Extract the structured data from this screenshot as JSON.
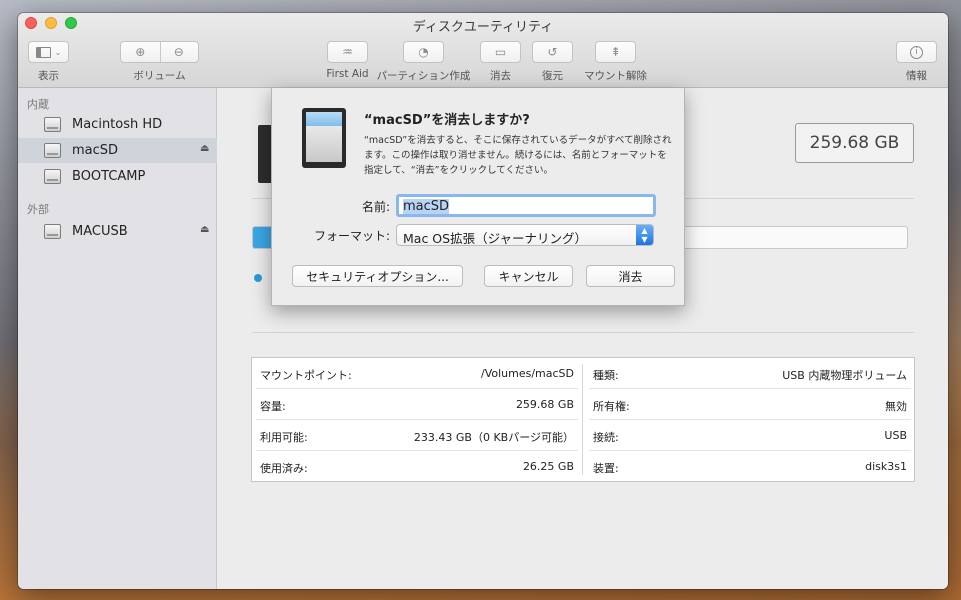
{
  "window": {
    "title": "ディスクユーティリティ"
  },
  "toolbar": {
    "view_label": "表示",
    "volume_label": "ボリューム",
    "first_aid_label": "First Aid",
    "partition_label": "パーティション作成",
    "erase_label": "消去",
    "restore_label": "復元",
    "unmount_label": "マウント解除",
    "info_label": "情報"
  },
  "sidebar": {
    "internal_header": "内蔵",
    "external_header": "外部",
    "internal_items": [
      {
        "label": "Macintosh HD"
      },
      {
        "label": "macSD",
        "selected": true
      },
      {
        "label": "BOOTCAMP"
      }
    ],
    "external_items": [
      {
        "label": "MACUSB"
      }
    ]
  },
  "main": {
    "capacity": "259.68 GB"
  },
  "info": {
    "left": [
      {
        "key": "マウントポイント:",
        "value": "/Volumes/macSD"
      },
      {
        "key": "容量:",
        "value": "259.68 GB"
      },
      {
        "key": "利用可能:",
        "value": "233.43 GB（0 KBパージ可能）"
      },
      {
        "key": "使用済み:",
        "value": "26.25 GB"
      }
    ],
    "right": [
      {
        "key": "種類:",
        "value": "USB 内蔵物理ボリューム"
      },
      {
        "key": "所有権:",
        "value": "無効"
      },
      {
        "key": "接続:",
        "value": "USB"
      },
      {
        "key": "装置:",
        "value": "disk3s1"
      }
    ]
  },
  "dialog": {
    "title": "“macSD”を消去しますか?",
    "message": "“macSD”を消去すると、そこに保存されているデータがすべて削除されます。この操作は取り消せません。続けるには、名前とフォーマットを指定して、“消去”をクリックしてください。",
    "name_label": "名前:",
    "name_value": "macSD",
    "format_label": "フォーマット:",
    "format_value": "Mac OS拡張（ジャーナリング）",
    "security_button": "セキュリティオプション...",
    "cancel_button": "キャンセル",
    "erase_button": "消去"
  }
}
